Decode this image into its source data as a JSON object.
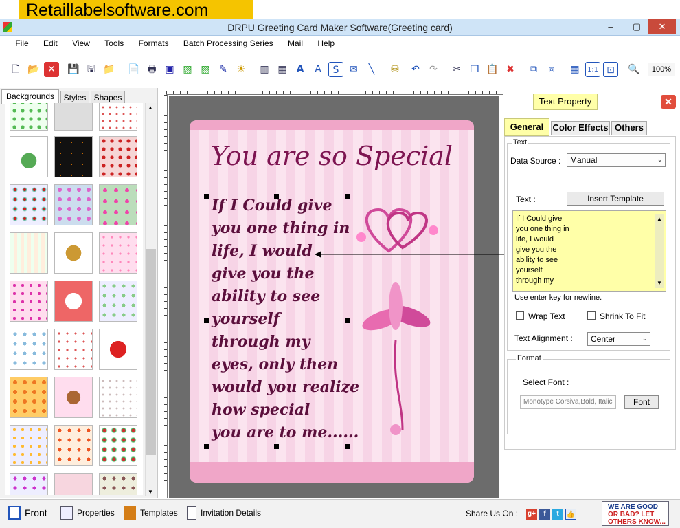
{
  "promo_banner": "Retaillabelsoftware.com",
  "window": {
    "title": "DRPU Greeting Card Maker Software(Greeting card)",
    "minimize": "–",
    "maximize": "▢",
    "close": "✕"
  },
  "menu": [
    "File",
    "Edit",
    "View",
    "Tools",
    "Formats",
    "Batch Processing Series",
    "Mail",
    "Help"
  ],
  "toolbar": {
    "zoom": "100%"
  },
  "left_tabs": [
    "Backgrounds",
    "Styles",
    "Shapes"
  ],
  "card": {
    "title": "You are so Special",
    "message_lines": [
      "If I Could give",
      "you one thing in",
      "life, I would",
      "give you the",
      "ability to see",
      "yourself",
      "through my",
      "eyes, only then",
      "would you realize",
      "how special",
      "you are to me......"
    ]
  },
  "right_panel": {
    "header": "Text Property",
    "tabs": [
      "General",
      "Color Effects",
      "Others"
    ],
    "group_text": "Text",
    "data_source_label": "Data Source :",
    "data_source_value": "Manual",
    "text_label": "Text :",
    "insert_template": "Insert Template",
    "text_lines": [
      "If I Could give",
      "you one thing in",
      "life, I would",
      "give you the",
      "ability to see",
      "yourself",
      "through my"
    ],
    "hint": "Use enter key for newline.",
    "wrap_text": "Wrap Text",
    "shrink_to_fit": "Shrink To Fit",
    "alignment_label": "Text Alignment :",
    "alignment_value": "Center",
    "group_format": "Format",
    "select_font_label": "Select Font :",
    "font_value": "Monotype Corsiva,Bold, Italic",
    "font_button": "Font"
  },
  "status": {
    "front": "Front",
    "properties": "Properties",
    "templates": "Templates",
    "invitation": "Invitation Details",
    "share_label": "Share Us On :",
    "feedback_lines": [
      "WE ARE GOOD",
      "OR BAD? LET",
      "OTHERS KNOW..."
    ]
  }
}
